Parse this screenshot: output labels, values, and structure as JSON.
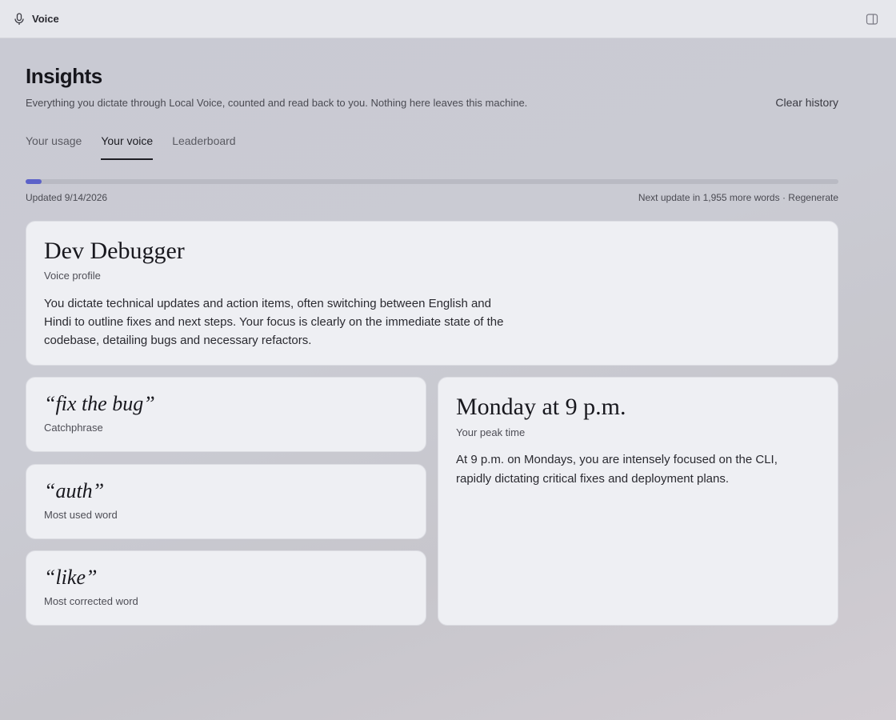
{
  "app": {
    "name": "Voice",
    "icon": "microphone-icon",
    "toggle_icon": "sidebar-panel-icon"
  },
  "header": {
    "title": "Insights",
    "subtitle": "Everything you dictate through Local Voice, counted and read back to you. Nothing here leaves this machine.",
    "clear_history_label": "Clear history"
  },
  "tabs": [
    {
      "label": "Your usage",
      "active": false
    },
    {
      "label": "Your voice",
      "active": true
    },
    {
      "label": "Leaderboard",
      "active": false
    }
  ],
  "progress": {
    "fraction": 0.02,
    "accent_color": "#5c62c9",
    "updated_text": "Updated 9/14/2026",
    "next_update_text": "Next update in 1,955 more words",
    "separator": " · ",
    "regenerate_label": "Regenerate"
  },
  "profile": {
    "name": "Dev Debugger",
    "caption": "Voice profile",
    "description": "You dictate technical updates and action items, often switching between English and Hindi to outline fixes and next steps. Your focus is clearly on the immediate state of the codebase, detailing bugs and necessary refactors."
  },
  "stats": [
    {
      "value": "“fix the bug”",
      "caption": "Catchphrase"
    },
    {
      "value": "“auth”",
      "caption": "Most used word"
    },
    {
      "value": "“like”",
      "caption": "Most corrected word"
    }
  ],
  "peak": {
    "title": "Monday at 9 p.m.",
    "caption": "Your peak time",
    "description": "At 9 p.m. on Mondays, you are intensely focused on the CLI, rapidly dictating critical fixes and deployment plans."
  }
}
